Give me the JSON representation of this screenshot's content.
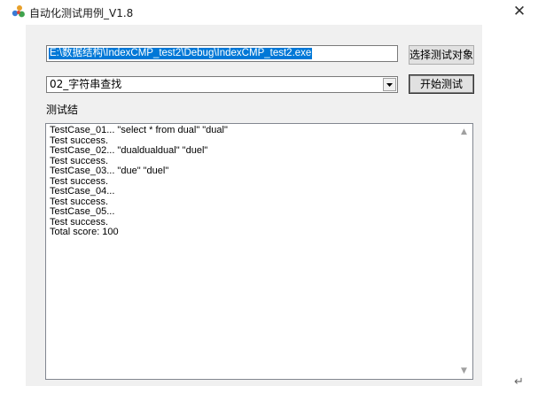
{
  "window": {
    "title": "自动化测试用例_V1.8",
    "close_glyph": "✕",
    "icon": "colorful-app-icon"
  },
  "target": {
    "path_value": "E:\\数据结构\\IndexCMP_test2\\Debug\\IndexCMP_test2.exe",
    "select_button_label": "选择测试对象"
  },
  "test_selector": {
    "selected_value": "02_字符串查找",
    "start_button_label": "开始测试"
  },
  "results": {
    "label": "测试结",
    "lines": [
      "TestCase_01... \"select * from dual\" \"dual\"",
      "Test success.",
      "TestCase_02... \"dualdualdual\" \"duel\"",
      "Test success.",
      "TestCase_03... \"due\" \"duel\"",
      "Test success.",
      "TestCase_04...",
      "Test success.",
      "TestCase_05...",
      "Test success.",
      "Total score: 100"
    ]
  },
  "colors": {
    "selection_highlight": "#0078d7",
    "dialog_background": "#f0f0f0"
  },
  "misc": {
    "return_glyph": "↵"
  }
}
